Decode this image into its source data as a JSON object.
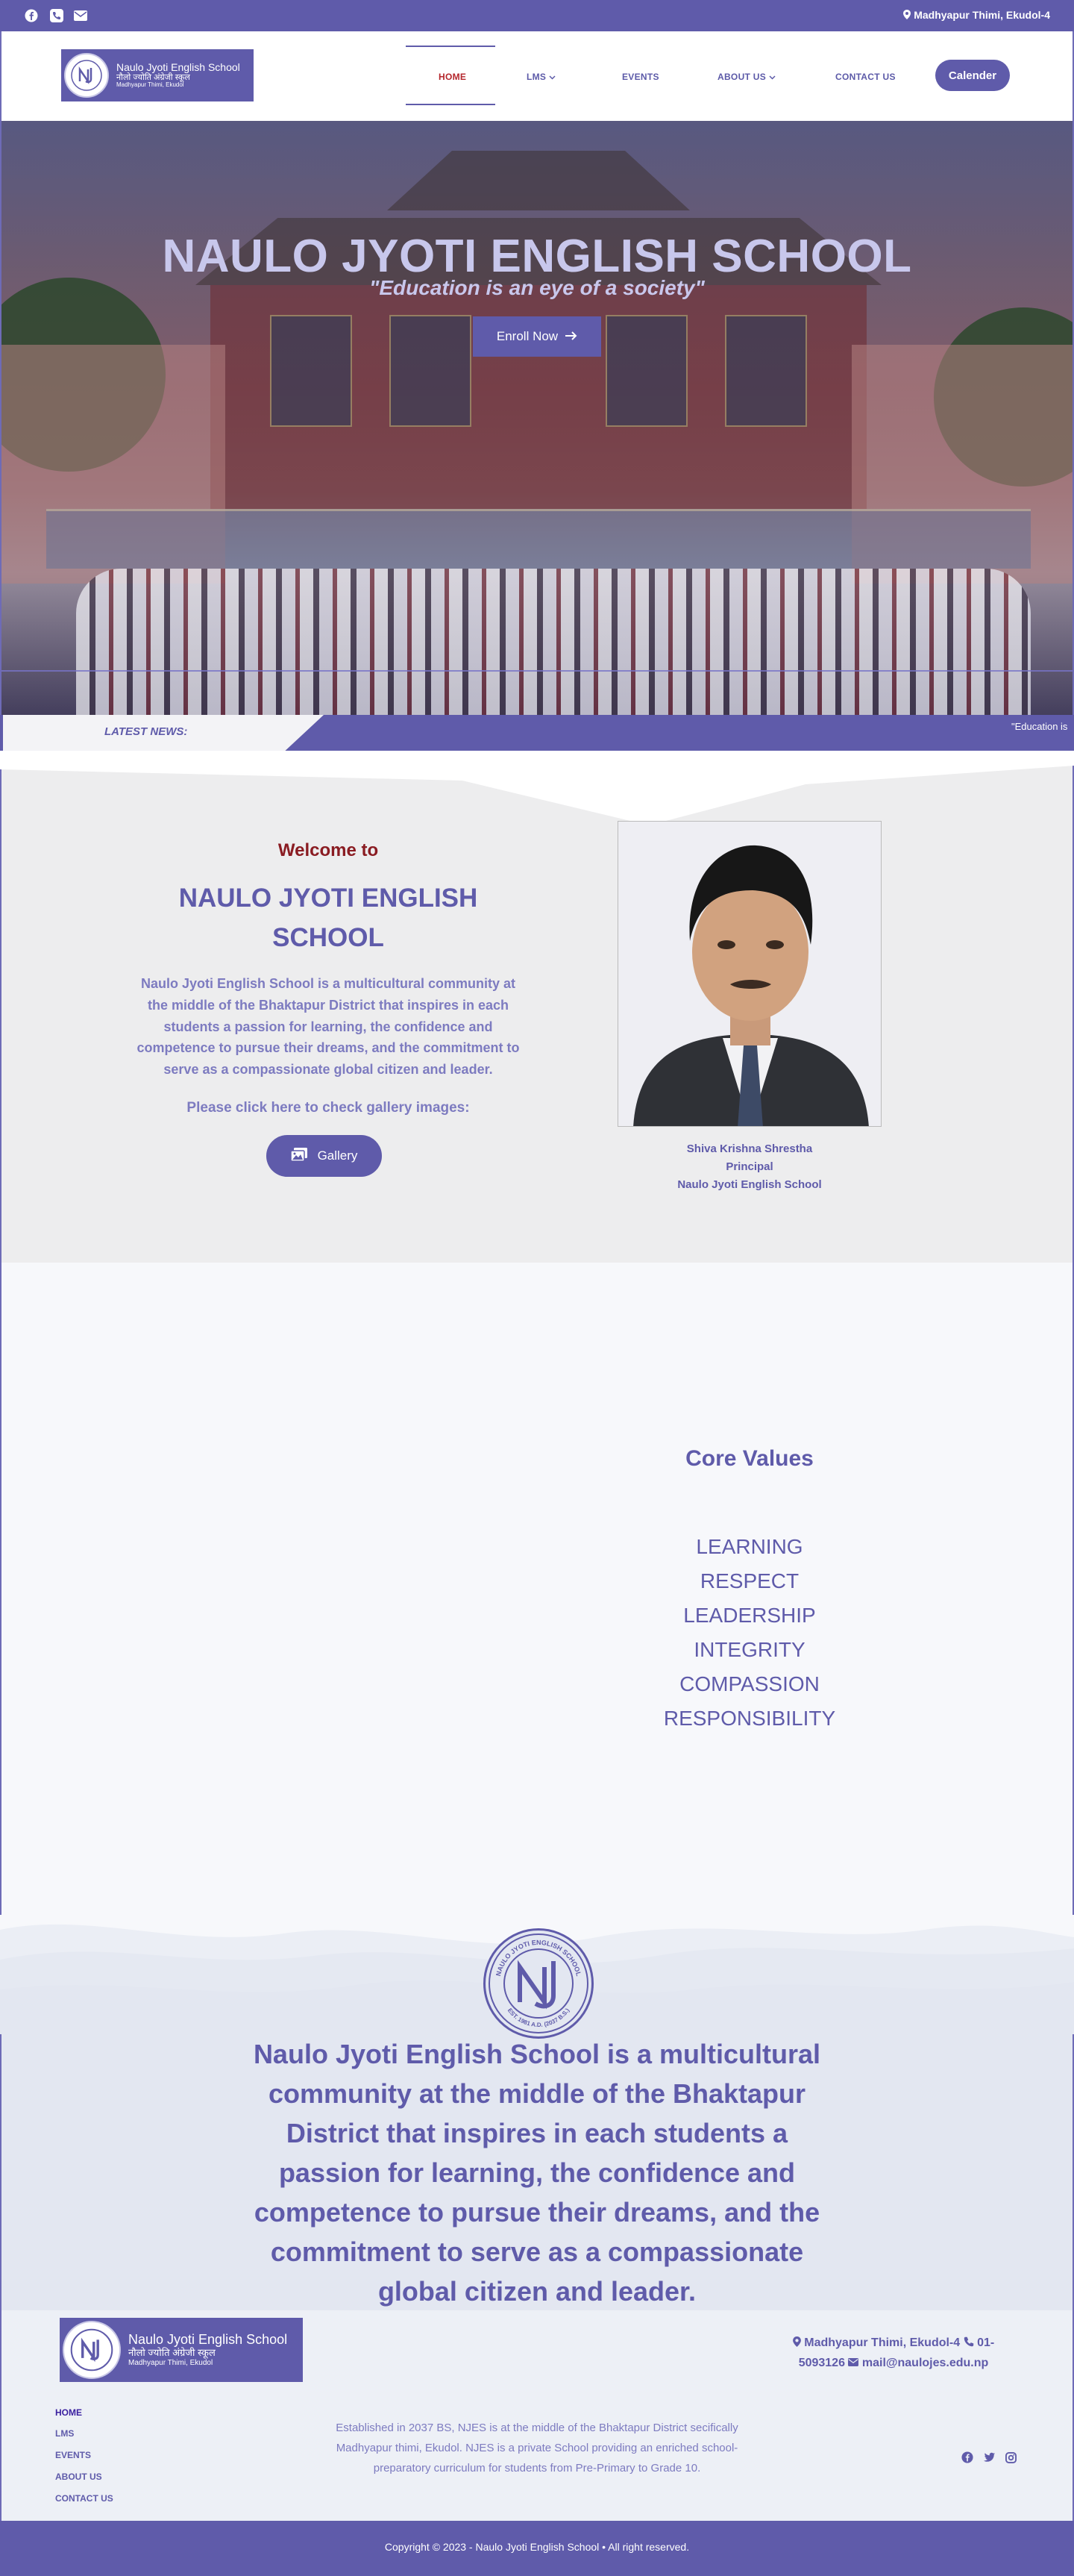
{
  "topbar": {
    "address": "Madhyapur Thimi, Ekudol-4",
    "icons": [
      "facebook-icon",
      "phone-icon",
      "mail-icon",
      "map-pin-icon"
    ]
  },
  "header": {
    "logo": {
      "name_en": "Naulo Jyoti English School",
      "name_np": "नौलो ज्योति अंग्रेजी स्कूल",
      "location": "Madhyapur Thimi, Ekudol"
    },
    "nav": [
      {
        "label": "HOME",
        "active": true
      },
      {
        "label": "LMS",
        "has_dropdown": true
      },
      {
        "label": "EVENTS"
      },
      {
        "label": "ABOUT US",
        "has_dropdown": true
      },
      {
        "label": "CONTACT US"
      }
    ],
    "calendar_label": "Calender"
  },
  "hero": {
    "title": "NAULO JYOTI ENGLISH SCHOOL",
    "subtitle": "\"Education is an eye of a society\"",
    "enroll_label": "Enroll Now"
  },
  "news": {
    "label": "LATEST NEWS:",
    "ticker": "\"Education is"
  },
  "welcome": {
    "heading": "Welcome to",
    "school_name": "NAULO JYOTI ENGLISH SCHOOL",
    "description": "Naulo Jyoti English School is a multicultural community at the middle of the Bhaktapur District that inspires in each students a passion for learning, the confidence and competence to pursue their dreams, and the commitment to serve as a compassionate global citizen and leader.",
    "gallery_prompt": "Please click here to check gallery images:",
    "gallery_label": "Gallery",
    "principal": {
      "name": "Shiva Krishna Shrestha",
      "role": "Principal",
      "school": "Naulo Jyoti English School"
    }
  },
  "core_values": {
    "title": "Core Values",
    "items": [
      "LEARNING",
      "RESPECT",
      "LEADERSHIP",
      "INTEGRITY",
      "COMPASSION",
      "RESPONSIBILITY"
    ]
  },
  "mission": {
    "seal_text": "NAULO JYOTI ENGLISH SCHOOL",
    "seal_est": "EST. 1981 A.D. (2037 B.S.)",
    "text": "Naulo Jyoti English School is a multicultural community at the middle of the Bhaktapur District that inspires in each students a passion for learning, the confidence and competence to pursue their dreams, and the commitment to serve as a compassionate global citizen and leader."
  },
  "footer": {
    "contact_address": "Madhyapur Thimi, Ekudol-4",
    "contact_phone": "01-5093126",
    "contact_email": "mail@naulojes.edu.np",
    "links": [
      {
        "label": "HOME",
        "active": true
      },
      {
        "label": "LMS"
      },
      {
        "label": "EVENTS"
      },
      {
        "label": "ABOUT US"
      },
      {
        "label": "CONTACT US"
      }
    ],
    "about": "Established in 2037 BS, NJES is at the middle of the Bhaktapur District secifically Madhyapur thimi, Ekudol. NJES is a private School providing an enriched school-preparatory curriculum for students from Pre-Primary to Grade 10.",
    "social": [
      "facebook-icon",
      "twitter-icon",
      "instagram-icon"
    ],
    "copyright": "Copyright © 2023 - Naulo Jyoti English School • All right reserved."
  },
  "colors": {
    "brand": "#5f5baa",
    "accent_red": "#b4262c",
    "welcome_bg": "#ededee",
    "mission_bg": "#e3e7f1"
  }
}
